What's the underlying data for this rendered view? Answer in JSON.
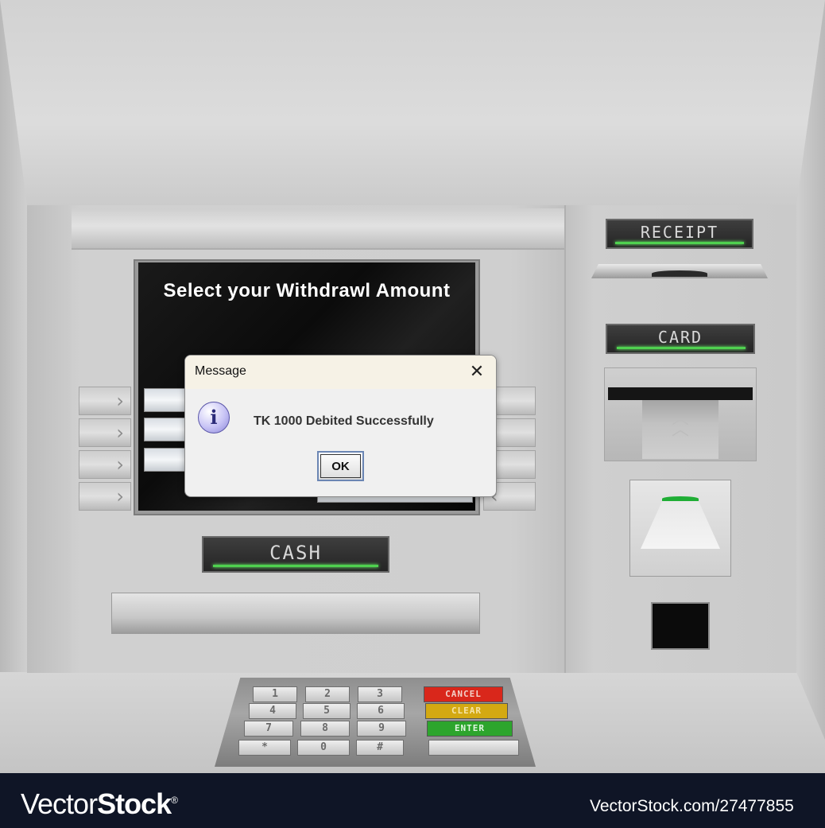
{
  "screen": {
    "title": "Select your Withdrawl Amount"
  },
  "side_keys": {
    "left_glyph": "›",
    "right_glyph": "‹"
  },
  "slots": {
    "receipt_label": "RECEIPT",
    "card_label": "CARD",
    "cash_label": "CASH"
  },
  "keypad": {
    "keys": [
      [
        "1",
        "2",
        "3"
      ],
      [
        "4",
        "5",
        "6"
      ],
      [
        "7",
        "8",
        "9"
      ],
      [
        "*",
        "0",
        "#"
      ]
    ],
    "cancel": "CANCEL",
    "clear": "CLEAR",
    "enter": "ENTER"
  },
  "dialog": {
    "title": "Message",
    "close_glyph": "✕",
    "icon_glyph": "i",
    "message": "TK 1000 Debited Successfully",
    "ok_label": "OK"
  },
  "footer": {
    "brand_light": "Vector",
    "brand_bold": "Stock",
    "brand_mark": "®",
    "image_id": "VectorStock.com/27477855"
  },
  "colors": {
    "cancel": "#d9271b",
    "clear": "#d3a912",
    "enter": "#2da52d",
    "led": "#4fd14f"
  }
}
